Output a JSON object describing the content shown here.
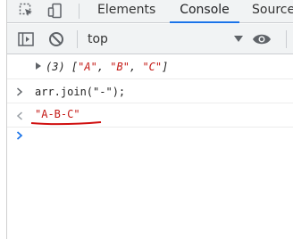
{
  "tabs": [
    {
      "label": "Elements",
      "active": false
    },
    {
      "label": "Console",
      "active": true
    },
    {
      "label": "Sources",
      "active": false
    }
  ],
  "toolbar": {
    "context": "top"
  },
  "console": {
    "entries": [
      {
        "kind": "output-array",
        "count": "(3)",
        "open_bracket": "[",
        "items": [
          "\"A\"",
          "\"B\"",
          "\"C\""
        ],
        "close_bracket": "]"
      },
      {
        "kind": "input",
        "code": "arr.join(\"-\");"
      },
      {
        "kind": "result",
        "value": "\"A-B-C\""
      }
    ]
  },
  "colors": {
    "accent_tab": "#1a73e8",
    "string": "#c41a16",
    "prompt": "#1a73e8",
    "underline": "#d01010"
  }
}
